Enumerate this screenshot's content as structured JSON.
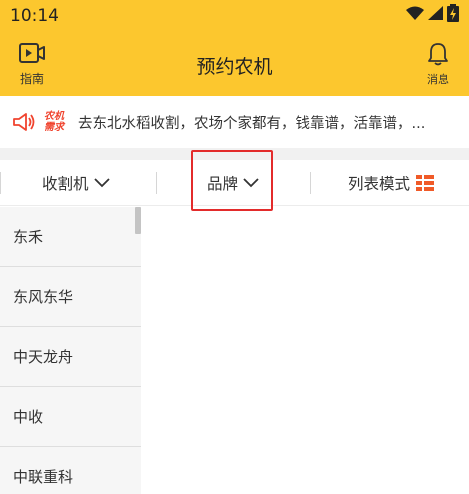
{
  "status_bar": {
    "time": "10:14"
  },
  "header": {
    "guide_label": "指南",
    "title": "预约农机",
    "message_label": "消息"
  },
  "notice": {
    "tag_line1": "农机",
    "tag_line2": "需求",
    "text": "去东北水稻收割，农场个家都有，钱靠谱，活靠谱，..."
  },
  "filters": {
    "harvester": "收割机",
    "brand": "品牌",
    "list_mode": "列表模式"
  },
  "brands": [
    {
      "label": "东禾"
    },
    {
      "label": "东风东华"
    },
    {
      "label": "中天龙舟"
    },
    {
      "label": "中收"
    },
    {
      "label": "中联重科"
    }
  ],
  "colors": {
    "accent": "#fcc72e",
    "notice_red": "#f0442f",
    "list_icon": "#f05a28",
    "highlight": "#e32b2b"
  }
}
